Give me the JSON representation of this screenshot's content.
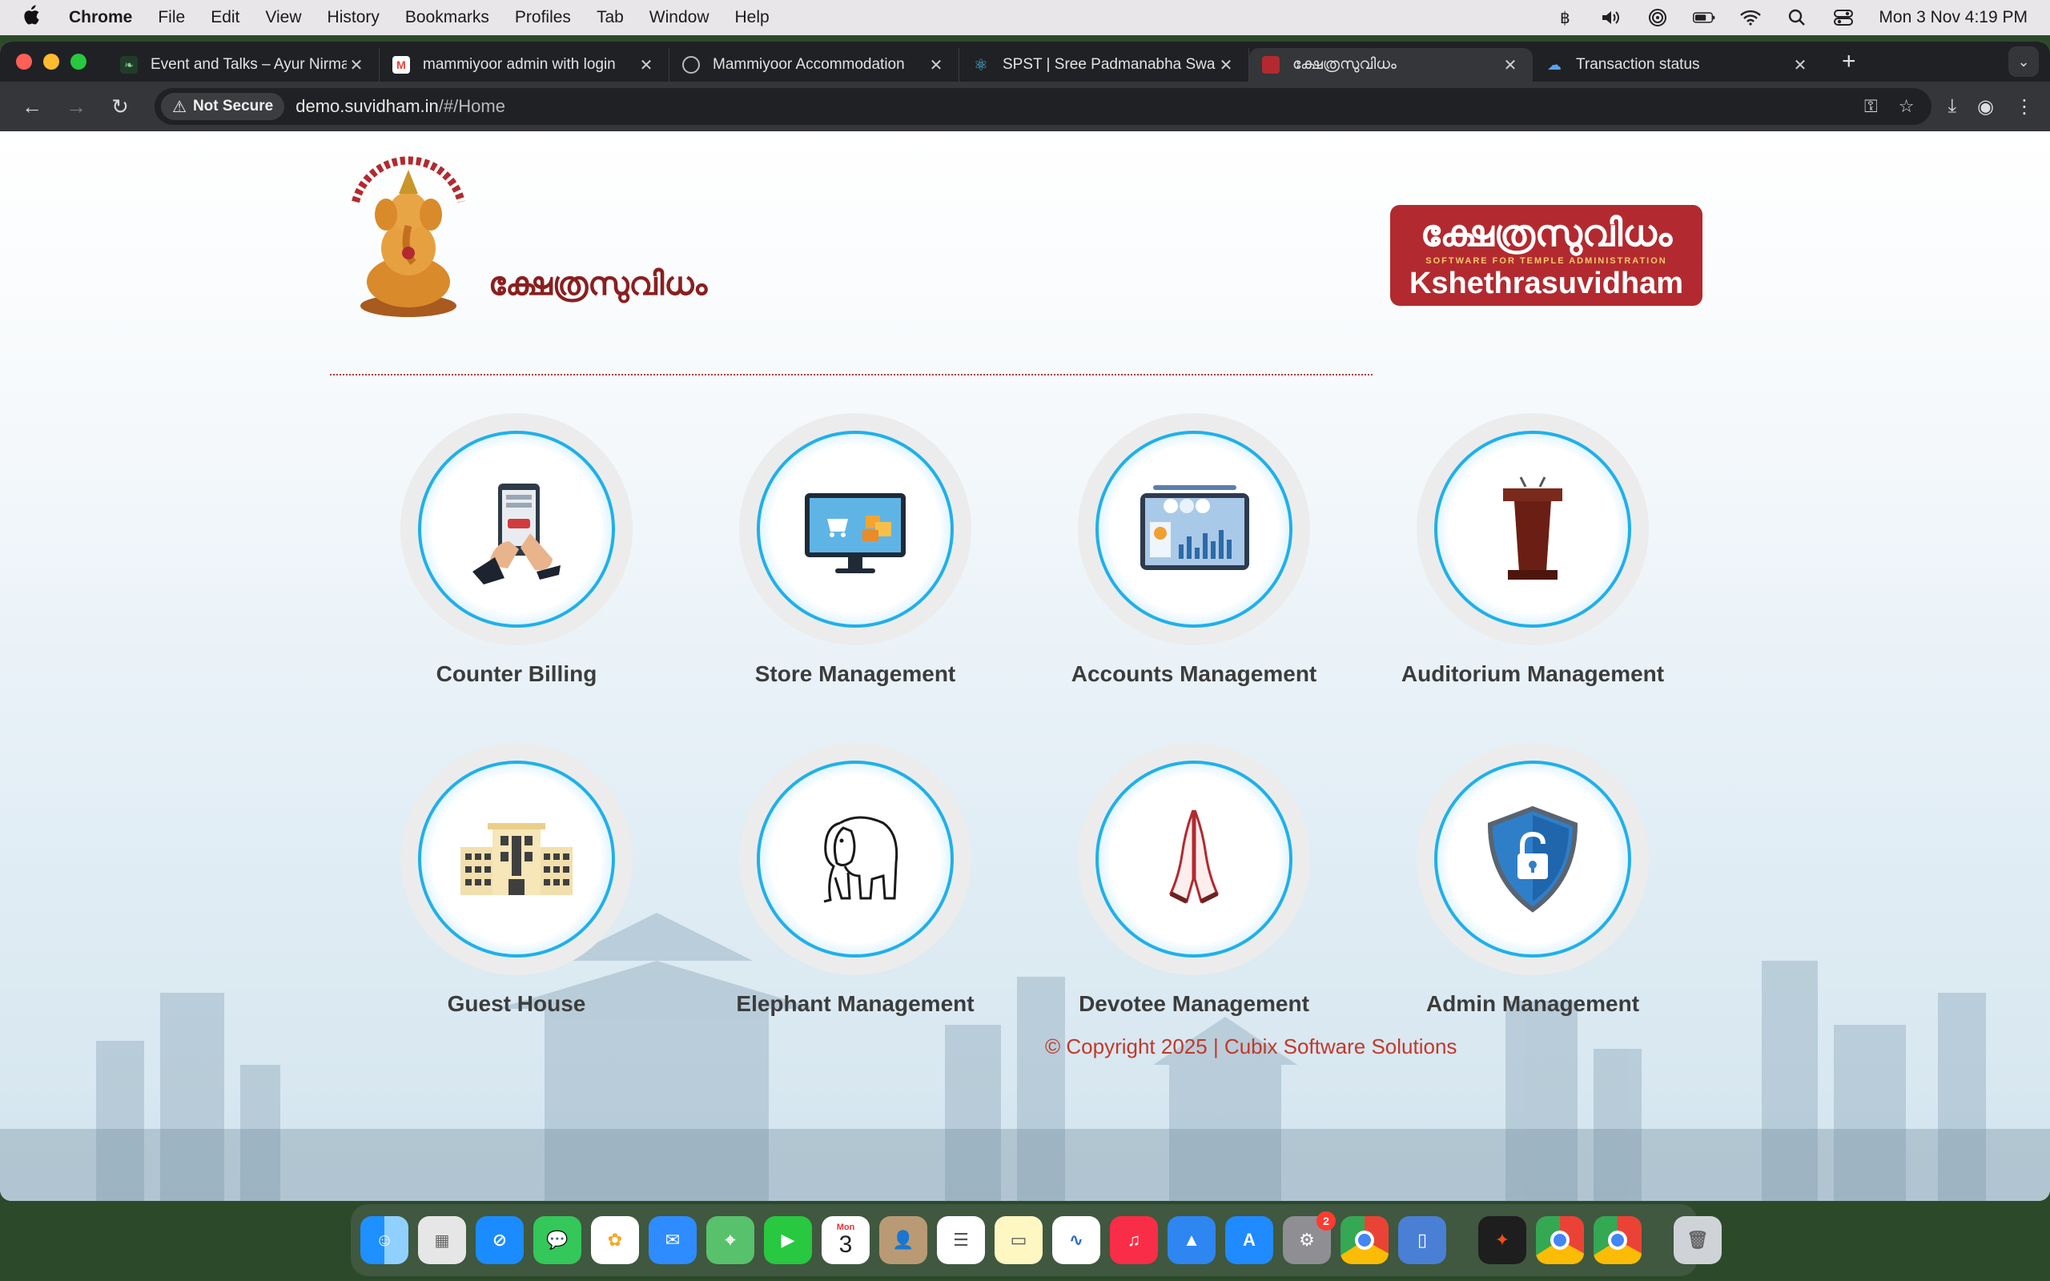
{
  "menubar": {
    "app": "Chrome",
    "items": [
      "File",
      "Edit",
      "View",
      "History",
      "Bookmarks",
      "Profiles",
      "Tab",
      "Window",
      "Help"
    ],
    "datetime": "Mon 3 Nov  4:19 PM"
  },
  "tabs": [
    {
      "title": "Event and Talks – Ayur Nirma",
      "fav_color": "#2a6b3b"
    },
    {
      "title": "mammiyoor admin with login",
      "fav_color": "#ea4335"
    },
    {
      "title": "Mammiyoor Accommodation",
      "fav_color": "#9aa0a6"
    },
    {
      "title": "SPST | Sree Padmanabha Swa",
      "fav_color": "#4fc3f7"
    },
    {
      "title": "ക്ഷേത്രസുവിധം",
      "fav_color": "#b22a2f"
    },
    {
      "title": "Transaction status",
      "fav_color": "#4a90e2"
    }
  ],
  "toolbar": {
    "security_label": "Not Secure",
    "url_host": "demo.suvidham.in",
    "url_path": "/#/Home"
  },
  "header": {
    "title": "ക്ഷേത്രസുവിധം",
    "brand_ml": "ക്ഷേത്രസുവിധം",
    "brand_tagline": "SOFTWARE FOR TEMPLE ADMINISTRATION",
    "brand_en": "Kshethrasuvidham"
  },
  "modules": [
    {
      "label": "Counter Billing",
      "icon": "counter-billing-icon"
    },
    {
      "label": "Store Management",
      "icon": "store-management-icon"
    },
    {
      "label": "Accounts Management",
      "icon": "accounts-management-icon"
    },
    {
      "label": "Auditorium Management",
      "icon": "auditorium-management-icon"
    },
    {
      "label": "Guest House",
      "icon": "guest-house-icon"
    },
    {
      "label": "Elephant Management",
      "icon": "elephant-icon"
    },
    {
      "label": "Devotee Management",
      "icon": "devotee-icon"
    },
    {
      "label": "Admin Management",
      "icon": "admin-lock-icon"
    }
  ],
  "footer": "© Copyright 2025 | Cubix Software Solutions",
  "dock": {
    "calendar_month": "Mon",
    "calendar_day": "3",
    "settings_badge": "2"
  }
}
